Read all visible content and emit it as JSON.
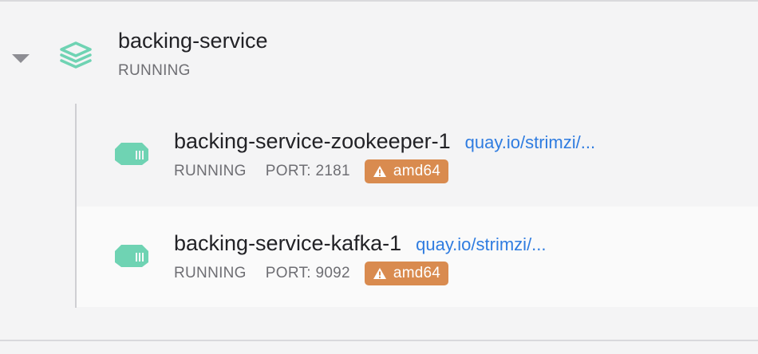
{
  "colors": {
    "accent_green": "#6fd3b3",
    "link_blue": "#2f7ce0",
    "warning_orange": "#d98b4f"
  },
  "group": {
    "name": "backing-service",
    "status": "RUNNING",
    "icon": "stack-icon",
    "expand_icon": "caret-down-icon"
  },
  "containers": [
    {
      "name": "backing-service-zookeeper-1",
      "image": "quay.io/strimzi/...",
      "status": "RUNNING",
      "port": "PORT: 2181",
      "arch_badge": "amd64",
      "icon": "container-icon",
      "badge_icon": "warning-icon"
    },
    {
      "name": "backing-service-kafka-1",
      "image": "quay.io/strimzi/...",
      "status": "RUNNING",
      "port": "PORT: 9092",
      "arch_badge": "amd64",
      "icon": "container-icon",
      "badge_icon": "warning-icon"
    }
  ]
}
